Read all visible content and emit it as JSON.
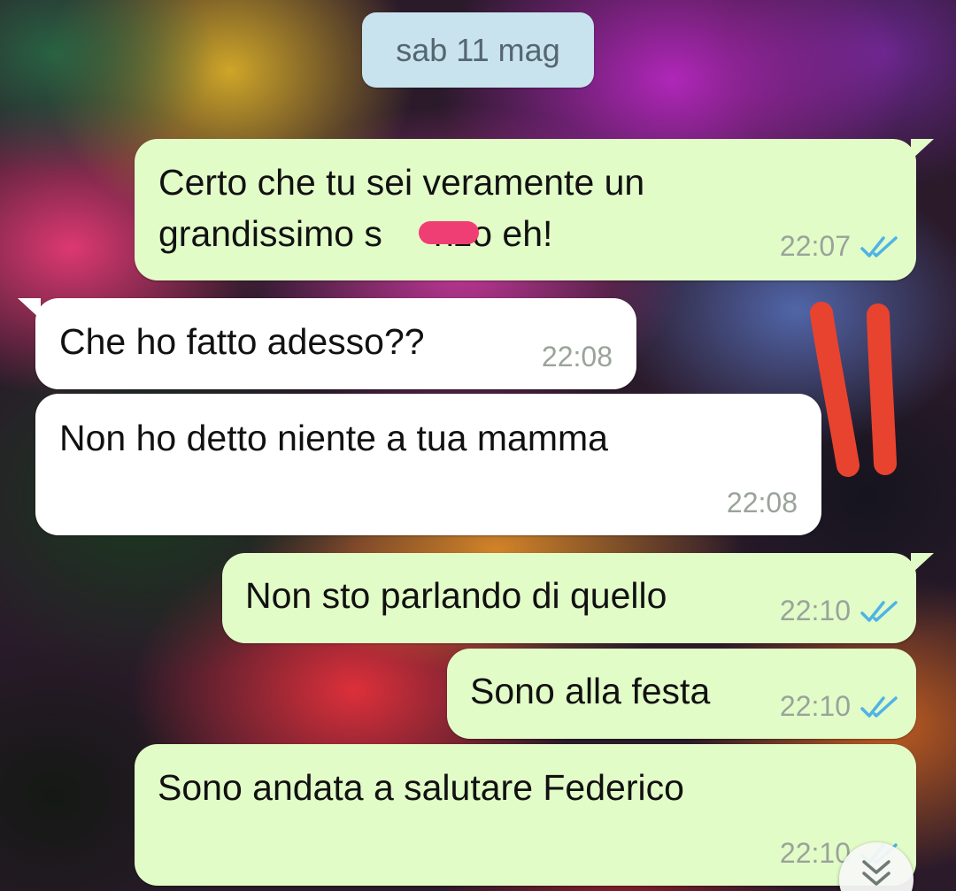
{
  "date_separator": "sab 11 mag",
  "messages": [
    {
      "direction": "outgoing",
      "lines": [
        "Certo che tu sei veramente un",
        "grandissimo s",
        "nzo eh!"
      ],
      "time": "22:07",
      "status": "read"
    },
    {
      "direction": "incoming",
      "lines": [
        "Che ho fatto adesso??"
      ],
      "time": "22:08"
    },
    {
      "direction": "incoming",
      "lines": [
        "Non ho detto niente a tua mamma"
      ],
      "time": "22:08"
    },
    {
      "direction": "outgoing",
      "lines": [
        "Non sto parlando di quello"
      ],
      "time": "22:10",
      "status": "read"
    },
    {
      "direction": "outgoing",
      "lines": [
        "Sono alla festa"
      ],
      "time": "22:10",
      "status": "read"
    },
    {
      "direction": "outgoing",
      "lines": [
        "Sono andata a salutare Federico"
      ],
      "time": "22:10",
      "status": "read"
    }
  ],
  "icons": {
    "read_receipt": "double-check-icon",
    "scroll_down": "double-chevron-down-icon"
  },
  "colors": {
    "outgoing_bubble": "#e2fcc8",
    "incoming_bubble": "#ffffff",
    "date_pill": "#c8e3ee",
    "read_check": "#4fb3e6",
    "redaction": "#ef3e73",
    "annotation_marks": "#e8432f"
  }
}
